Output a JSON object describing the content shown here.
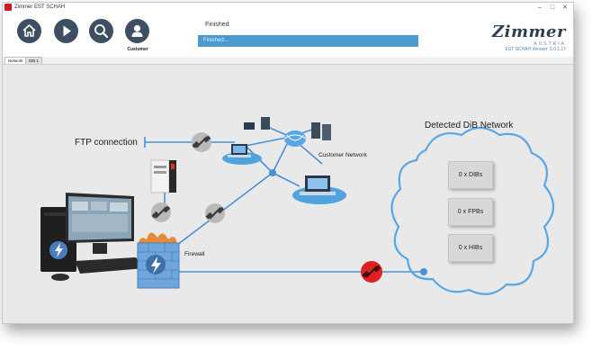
{
  "window": {
    "title": "Zimmer EST SCHAH",
    "controls": {
      "minimize": "–",
      "maximize": "□",
      "close": "✕"
    }
  },
  "toolbar": {
    "buttons": [
      {
        "name": "home",
        "icon": "home-icon"
      },
      {
        "name": "start",
        "icon": "play-icon"
      },
      {
        "name": "search",
        "icon": "search-icon"
      },
      {
        "name": "customer",
        "icon": "user-icon",
        "label": "Customer"
      }
    ],
    "status_text": "Finished",
    "progress": {
      "text": "Finished...",
      "value_percent": 100
    }
  },
  "brand": {
    "name": "Zimmer",
    "country": "AUSTRIA",
    "version": "EST SCHAH Version: 3.0.1.17"
  },
  "tabs": [
    {
      "label": "Network",
      "active": true
    },
    {
      "label": "DiB 1",
      "active": false
    }
  ],
  "network": {
    "ftp_label": "FTP connection",
    "customer_network_label": "Customer Network",
    "firewall_label": "Firewall",
    "dib_title": "Detected DiB Network",
    "dib_devices": [
      "0 x DIBs",
      "0 x FPBs",
      "0 x HIBs"
    ]
  },
  "colors": {
    "toolbar_button": "#3f4f63",
    "progress": "#4b9bd1",
    "network_line": "#4a90d9",
    "link_ok": "#b9b9b9",
    "link_broken": "#e02020",
    "brand": "#2d3e53"
  }
}
